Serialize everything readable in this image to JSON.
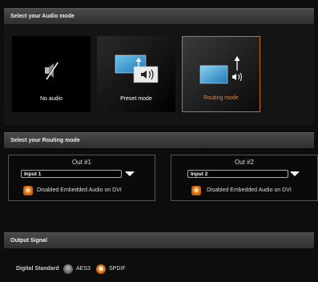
{
  "audio_mode": {
    "header": "Select your Audio mode",
    "tiles": [
      {
        "label": "No audio",
        "icon": "mute-speaker-icon",
        "selected": false
      },
      {
        "label": "Preset mode",
        "icon": "display-audio-preset-icon",
        "selected": false
      },
      {
        "label": "Routing mode",
        "icon": "display-audio-routing-icon",
        "selected": true
      }
    ]
  },
  "routing_mode": {
    "header": "Select your Routing mode",
    "outputs": [
      {
        "title": "Out #1",
        "input_value": "Input 1",
        "checkbox_label": "Disabled Embedded Audio on DVI"
      },
      {
        "title": "Out #2",
        "input_value": "Input 2",
        "checkbox_label": "Disabled Embedded Audio on DVI"
      }
    ]
  },
  "output_signal": {
    "header": "Output Signal",
    "label": "Digital Standard",
    "options": [
      {
        "label": "AES3",
        "selected": false
      },
      {
        "label": "SPDIF",
        "selected": true
      }
    ]
  },
  "colors": {
    "accent": "#e8862c",
    "header_bg": "#3a3a3a",
    "background": "#0d0d0d"
  }
}
